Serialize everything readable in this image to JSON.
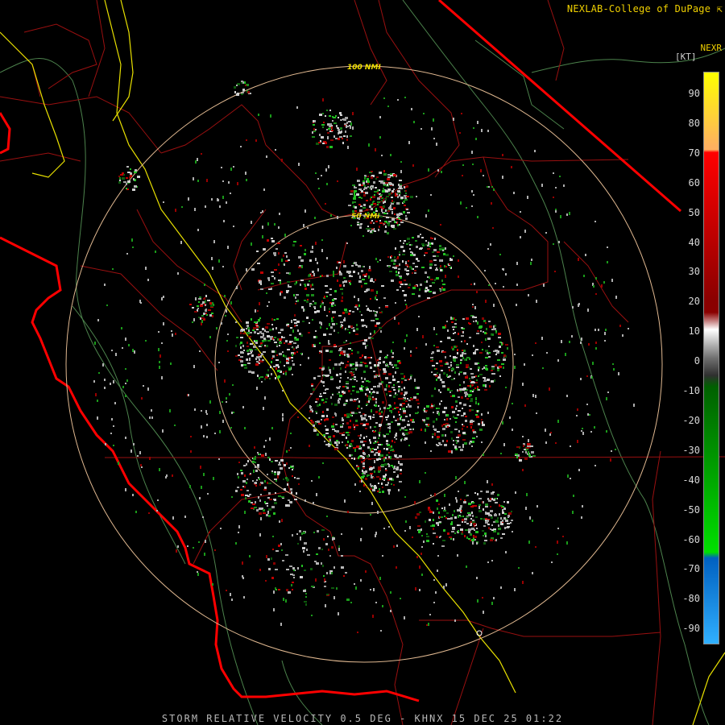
{
  "credit": "NEXLAB-College of DuPage",
  "credit_icon": "cursor-arrow-icon",
  "product": "NEXR",
  "units": "[KT]",
  "footer": "STORM RELATIVE VELOCITY 0.5 DEG - KHNX 15 DEC 25 01:22",
  "rings": [
    {
      "label": "50 NMI"
    },
    {
      "label": "100 NMI"
    }
  ],
  "scale": {
    "ticks": [
      "90",
      "80",
      "70",
      "60",
      "50",
      "40",
      "30",
      "20",
      "10",
      "0",
      "-10",
      "-20",
      "-30",
      "-40",
      "-50",
      "-60",
      "-70",
      "-80",
      "-90"
    ],
    "colors": [
      "#ffff00",
      "#ffb060",
      "#ff0000",
      "#8a0000",
      "#707070",
      "#006000",
      "#00e000",
      "#0060c0",
      "#30b0ff"
    ]
  },
  "colors": {
    "county_lines": "#a01010",
    "state_line": "#ff0000",
    "highway": "#ffff00",
    "terrain_lines": "#60a060",
    "rings": "#e0c080"
  }
}
